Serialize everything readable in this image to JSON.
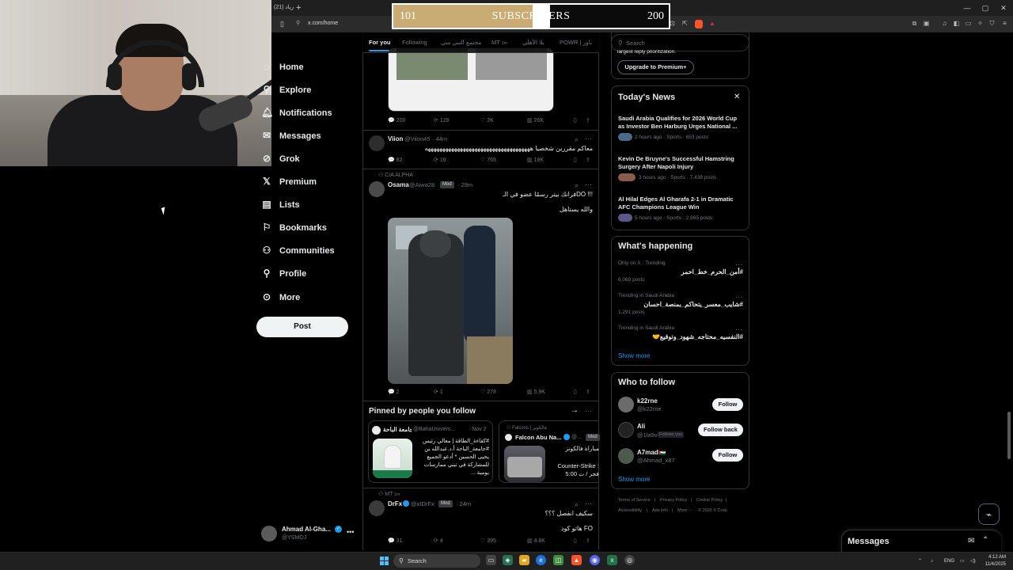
{
  "browser": {
    "tab_title": "(21) زياد",
    "new_tab": "+",
    "url": "x.com/home",
    "window_controls": [
      "—",
      "▢",
      "✕"
    ]
  },
  "overlay": {
    "sub_current": "101",
    "sub_label": "SUBSCRIBERS",
    "sub_goal": "200",
    "progress_fraction": 0.505
  },
  "nav": {
    "items": [
      {
        "label": "Home",
        "icon": "home-icon"
      },
      {
        "label": "Explore",
        "icon": "explore-icon"
      },
      {
        "label": "Notifications",
        "icon": "bell-icon"
      },
      {
        "label": "Messages",
        "icon": "mail-icon"
      },
      {
        "label": "Grok",
        "icon": "grok-icon"
      },
      {
        "label": "Premium",
        "icon": "x-logo-icon"
      },
      {
        "label": "Lists",
        "icon": "list-icon"
      },
      {
        "label": "Bookmarks",
        "icon": "bookmark-icon"
      },
      {
        "label": "Communities",
        "icon": "people-icon"
      },
      {
        "label": "Profile",
        "icon": "person-icon"
      },
      {
        "label": "More",
        "icon": "more-circle-icon"
      }
    ],
    "post_button": "Post",
    "account": {
      "name": "Ahmad Al-Gha...",
      "handle": "@YSMOJ"
    }
  },
  "timeline": {
    "tabs": [
      "For you",
      "Following",
      "مجتمع النبي سي",
      "MT",
      "يلا الأهلي",
      "POWR | باور"
    ],
    "tab_mt_count": "1m",
    "tweet0": {
      "replies": "200",
      "retweets": "128",
      "likes": "2K",
      "views": "26K"
    },
    "tweet1": {
      "name": "Viion",
      "handle": "@Viion45",
      "time": "· 44m",
      "text": "معاكم مقررين شخصيا ههههههههههههههههههههههههههههههههههههه",
      "replies": "82",
      "retweets": "16",
      "likes": "765",
      "views": "18K"
    },
    "tweet2": {
      "community": "CIA ALPHA",
      "name": "Osama",
      "handle": "@Aiwa28",
      "badge": "Mod",
      "time": "· 29m",
      "text_line1": "فرانك بيتر رسمًا عضو في الـDO !!!",
      "text_line2": "والله يستاهل",
      "replies": "2",
      "retweets": "1",
      "likes": "278",
      "views": "5.9K"
    },
    "pinned": {
      "title": "Pinned by people you follow",
      "card1": {
        "name": "جامعة الباحة",
        "handle": "@BahaUnivers...",
        "time": "· Nov 2",
        "text": "#كفاءة_الطاقة | معالي رئيس #جامعة_الباحة أ.د.عبدالله بن يحيى الحسين * أدعو الجميع للمشاركة في تبني ممارسات يومية ..."
      },
      "card2": {
        "community": "Falcons | فالكونز",
        "name": "Falcon Abu Na...",
        "handle": "@...",
        "badge": "Mod",
        "text1": "مباراة فالكونز",
        "text2": "Counter-Strike :",
        "text3": "5:00 فجر / ت"
      }
    },
    "tweet3": {
      "community": "MT",
      "community_count": "1m",
      "name": "DrFx",
      "handle": "@xIDrFx",
      "badge": "Mod",
      "time": "· 24m",
      "text_line1": "سكيف انفصل ؟؟؟",
      "text_line2": "هاتو كود FO",
      "replies": "31",
      "retweets": "4",
      "likes": "395",
      "views": "4.8K"
    }
  },
  "right": {
    "search_placeholder": "Search",
    "premium_tail": "largest reply prioritization.",
    "premium_button": "Upgrade to Premium+",
    "news_title": "Today's News",
    "news": [
      {
        "title": "Saudi Arabia Qualifies for 2026 World Cup as Investor Ben Harburg Urges National ...",
        "meta": "2 hours ago · Sports · 653 posts"
      },
      {
        "title": "Kevin De Bruyne's Successful Hamstring Surgery After Napoli Injury",
        "meta": "3 hours ago · Sports · 7,438 posts"
      },
      {
        "title": "Al Hilal Edges Al Gharafa 2-1 in Dramatic AFC Champions League Win",
        "meta": "5 hours ago · Sports · 2,865 posts"
      }
    ],
    "happening_title": "What's happening",
    "trends": [
      {
        "label": "Only on X · Trending",
        "tag": "#أمن_الحرم_خط_احمر",
        "posts": "6,069 posts"
      },
      {
        "label": "Trending in Saudi Arabia",
        "tag": "#شايب_معسر_يتحاكم_بمنصة_احسان",
        "posts": "1,291 posts"
      },
      {
        "label": "Trending in Saudi Arabia",
        "tag": "#النفسيه_محتاجه_شهود_وتوقيع🤝",
        "posts": ""
      }
    ],
    "show_more": "Show more",
    "who_title": "Who to follow",
    "who": [
      {
        "name": "k22rne",
        "handle": "@k22rne",
        "button": "Follow",
        "extra": ""
      },
      {
        "name": "Ali",
        "handle": "@1la9v",
        "button": "Follow back",
        "extra": "Follows you"
      },
      {
        "name": "A7mad🇵🇸",
        "handle": "@Ahmad_x87",
        "button": "Follow",
        "extra": ""
      }
    ],
    "show_more2": "Show more",
    "footer": [
      "Terms of Service",
      "|",
      "Privacy Policy",
      "|",
      "Cookie Policy",
      "|",
      "Accessibility",
      "|",
      "Ads info",
      "|",
      "More ···",
      "© 2025 X Corp."
    ],
    "messages": "Messages"
  },
  "taskbar": {
    "search": "Search",
    "lang": "ENG",
    "time": "4:12 AM",
    "date": "11/4/2025"
  }
}
